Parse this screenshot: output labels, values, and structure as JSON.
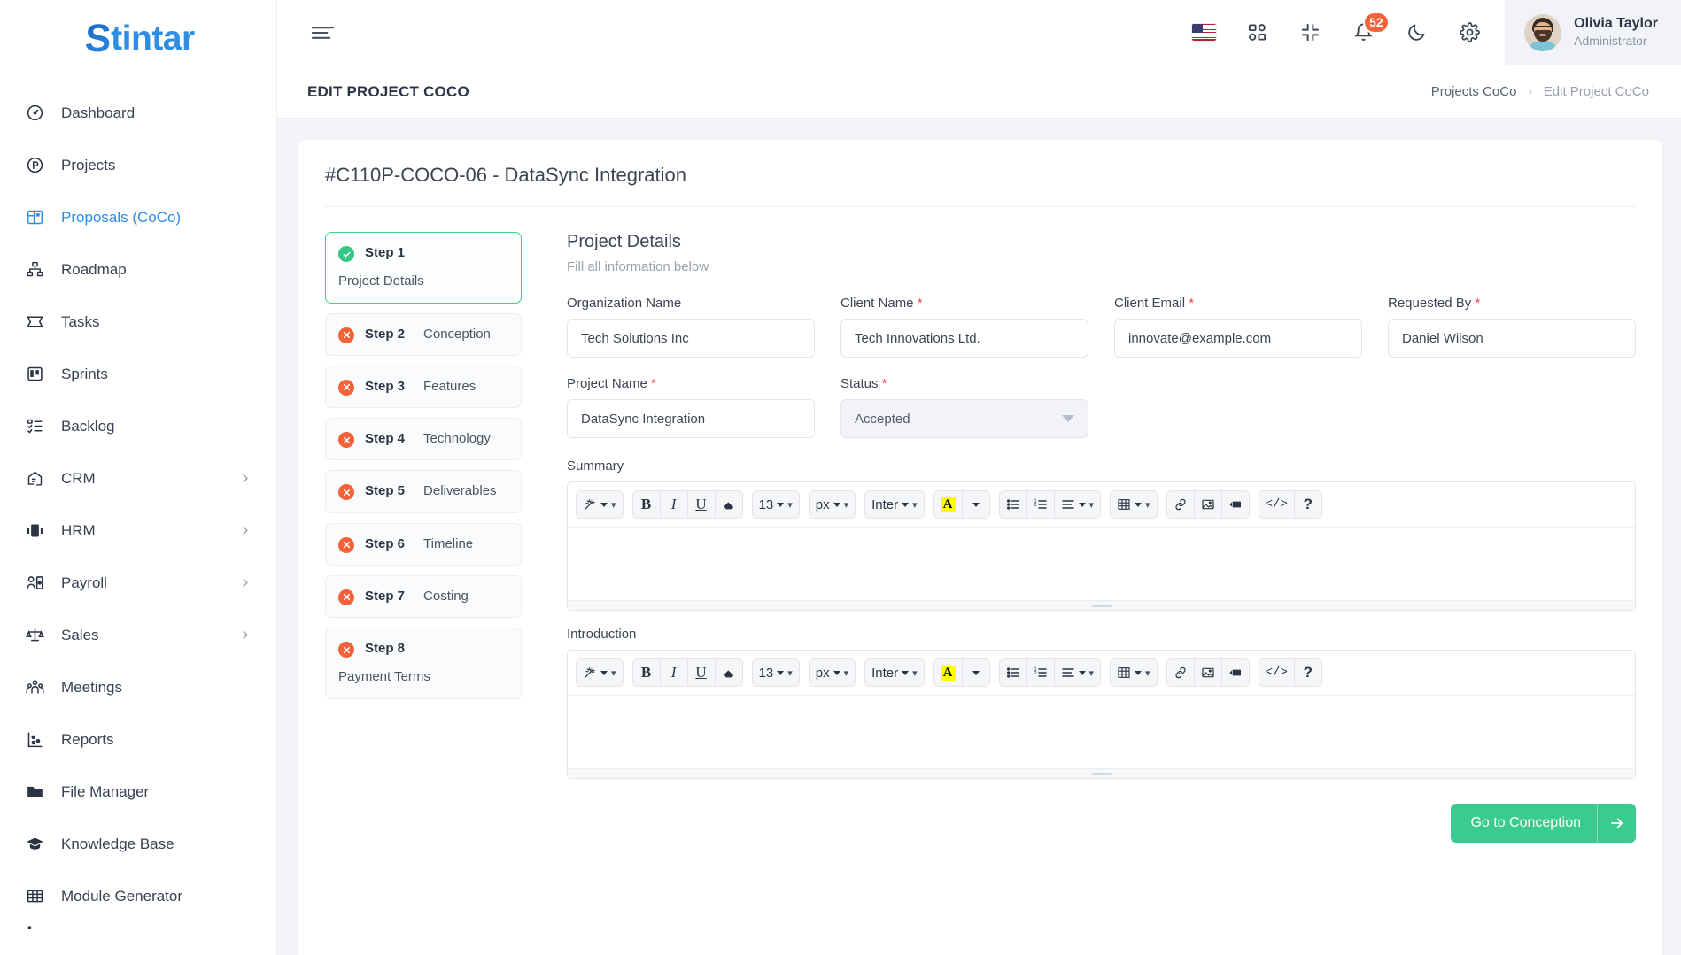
{
  "brand": {
    "name_s": "S",
    "name_rest": "tintar"
  },
  "sidebar": {
    "items": [
      {
        "label": "Dashboard",
        "icon": "dashboard-icon",
        "active": false,
        "expandable": false
      },
      {
        "label": "Projects",
        "icon": "projects-icon",
        "active": false,
        "expandable": false
      },
      {
        "label": "Proposals (CoCo)",
        "icon": "proposals-icon",
        "active": true,
        "expandable": false
      },
      {
        "label": "Roadmap",
        "icon": "roadmap-icon",
        "active": false,
        "expandable": false
      },
      {
        "label": "Tasks",
        "icon": "tasks-icon",
        "active": false,
        "expandable": false
      },
      {
        "label": "Sprints",
        "icon": "sprints-icon",
        "active": false,
        "expandable": false
      },
      {
        "label": "Backlog",
        "icon": "backlog-icon",
        "active": false,
        "expandable": false
      },
      {
        "label": "CRM",
        "icon": "crm-icon",
        "active": false,
        "expandable": true
      },
      {
        "label": "HRM",
        "icon": "hrm-icon",
        "active": false,
        "expandable": true
      },
      {
        "label": "Payroll",
        "icon": "payroll-icon",
        "active": false,
        "expandable": true
      },
      {
        "label": "Sales",
        "icon": "sales-icon",
        "active": false,
        "expandable": true
      },
      {
        "label": "Meetings",
        "icon": "meetings-icon",
        "active": false,
        "expandable": false
      },
      {
        "label": "Reports",
        "icon": "reports-icon",
        "active": false,
        "expandable": false
      },
      {
        "label": "File Manager",
        "icon": "folder-icon",
        "active": false,
        "expandable": false
      },
      {
        "label": "Knowledge Base",
        "icon": "graduation-cap-icon",
        "active": false,
        "expandable": false
      },
      {
        "label": "Module Generator",
        "icon": "grid-table-icon",
        "active": false,
        "expandable": false
      }
    ]
  },
  "topbar": {
    "menu_icon": "hamburger-icon",
    "language_flag": "us-flag-icon",
    "apps_icon": "apps-grid-icon",
    "fullscreen_icon": "compress-icon",
    "notifications_icon": "bell-icon",
    "notifications_count": "52",
    "theme_icon": "moon-icon",
    "settings_icon": "gear-icon",
    "user": {
      "name": "Olivia Taylor",
      "role": "Administrator",
      "avatar": "user-avatar"
    }
  },
  "page": {
    "title": "EDIT PROJECT COCO",
    "breadcrumb": {
      "parent": "Projects CoCo",
      "separator": "›",
      "current": "Edit Project CoCo"
    }
  },
  "card": {
    "title": "#C110P-COCO-06 - DataSync Integration"
  },
  "steps": [
    {
      "num": "Step 1",
      "label": "Project Details",
      "state": "done",
      "icon": "check-circle-icon"
    },
    {
      "num": "Step 2",
      "label": "Conception",
      "state": "pending",
      "icon": "x-circle-icon"
    },
    {
      "num": "Step 3",
      "label": "Features",
      "state": "pending",
      "icon": "x-circle-icon"
    },
    {
      "num": "Step 4",
      "label": "Technology",
      "state": "pending",
      "icon": "x-circle-icon"
    },
    {
      "num": "Step 5",
      "label": "Deliverables",
      "state": "pending",
      "icon": "x-circle-icon"
    },
    {
      "num": "Step 6",
      "label": "Timeline",
      "state": "pending",
      "icon": "x-circle-icon"
    },
    {
      "num": "Step 7",
      "label": "Costing",
      "state": "pending",
      "icon": "x-circle-icon"
    },
    {
      "num": "Step 8",
      "label": "Payment Terms",
      "state": "pending",
      "icon": "x-circle-icon"
    }
  ],
  "form": {
    "heading": "Project Details",
    "subheading": "Fill all information below",
    "fields": {
      "organization_name": {
        "label": "Organization Name",
        "required": false,
        "value": "Tech Solutions Inc"
      },
      "client_name": {
        "label": "Client Name",
        "required": true,
        "value": "Tech Innovations Ltd."
      },
      "client_email": {
        "label": "Client Email",
        "required": true,
        "value": "innovate@example.com"
      },
      "requested_by": {
        "label": "Requested By",
        "required": true,
        "value": "Daniel Wilson"
      },
      "project_name": {
        "label": "Project Name",
        "required": true,
        "value": "DataSync Integration"
      },
      "status": {
        "label": "Status",
        "required": true,
        "value": "Accepted"
      }
    },
    "required_mark": "*",
    "summary": {
      "label": "Summary",
      "value": ""
    },
    "introduction": {
      "label": "Introduction",
      "value": ""
    },
    "next_button": {
      "label": "Go to Conception",
      "icon": "arrow-right-icon"
    }
  },
  "editor_toolbar": {
    "font_size": "13",
    "unit": "px",
    "font_family": "Inter",
    "buttons": [
      {
        "name": "magic-wand-icon",
        "label": ""
      },
      {
        "name": "bold-button",
        "label": "B"
      },
      {
        "name": "italic-button",
        "label": "I"
      },
      {
        "name": "underline-button",
        "label": "U"
      },
      {
        "name": "eraser-button",
        "label": ""
      },
      {
        "name": "text-color-button",
        "label": "A"
      },
      {
        "name": "bullet-list-button",
        "label": ""
      },
      {
        "name": "numbered-list-button",
        "label": ""
      },
      {
        "name": "align-button",
        "label": ""
      },
      {
        "name": "table-button",
        "label": ""
      },
      {
        "name": "link-button",
        "label": ""
      },
      {
        "name": "image-button",
        "label": ""
      },
      {
        "name": "video-button",
        "label": ""
      },
      {
        "name": "code-view-button",
        "label": "</>"
      },
      {
        "name": "help-button",
        "label": "?"
      }
    ]
  },
  "colors": {
    "accent_blue": "#2f8de4",
    "success_green": "#3ccb8e",
    "danger_red": "#f4623a",
    "required_red": "#f0444a"
  }
}
